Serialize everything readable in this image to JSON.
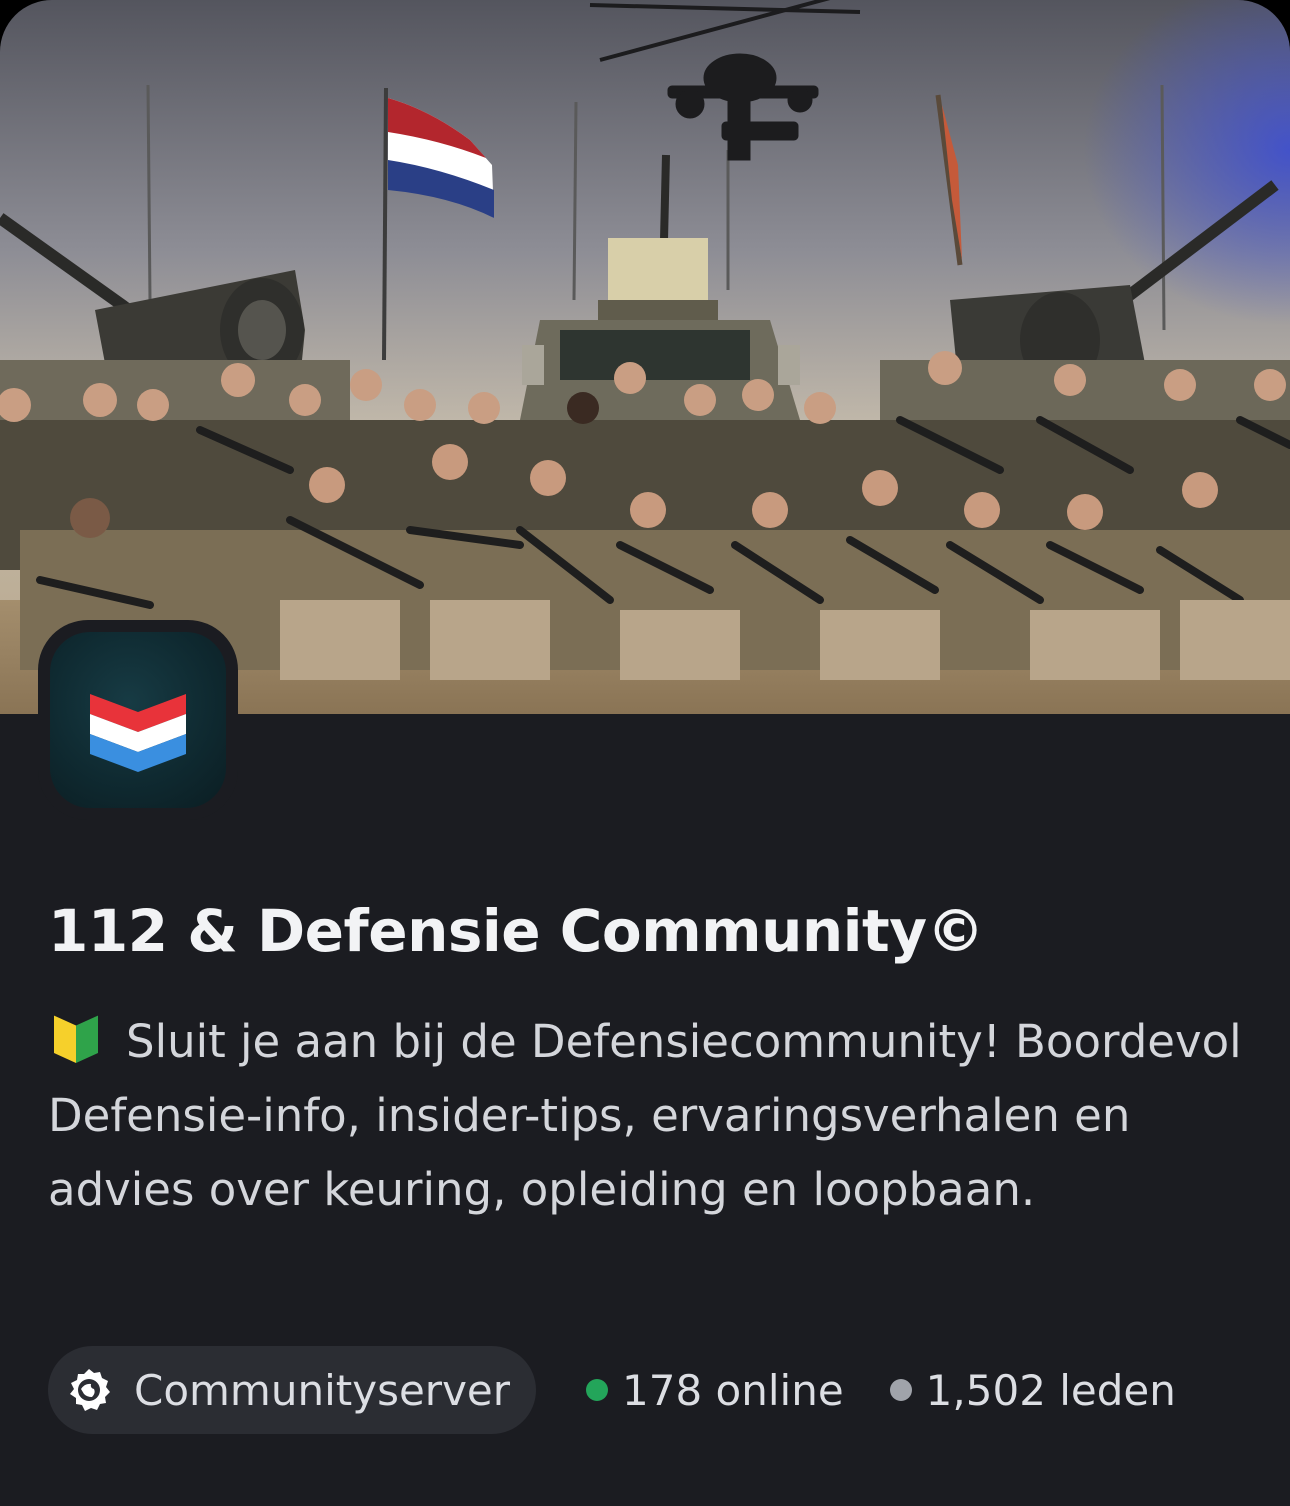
{
  "server": {
    "name": "112 & Defensie Community©",
    "description": "Sluit je aan bij de Defensiecommunity! Boordevol Defensie-info, insider-tips, ervaringsverhalen en advies over keuring, opleiding en loopbaan.",
    "description_emoji": "beginner-badge-icon",
    "type_label": "Communityserver",
    "type_icon": "community-server-icon",
    "online": "178 online",
    "members": "1,502 leden"
  },
  "colors": {
    "background": "#1b1c21",
    "pill": "#2b2d33",
    "online_dot": "#23a55a",
    "members_dot": "#a0a3aa",
    "title": "#f2f3f5",
    "text": "#d4d6db"
  },
  "icons": {
    "banner": "military-group-photo",
    "server_logo": "dutch-flag-chevron-icon"
  }
}
